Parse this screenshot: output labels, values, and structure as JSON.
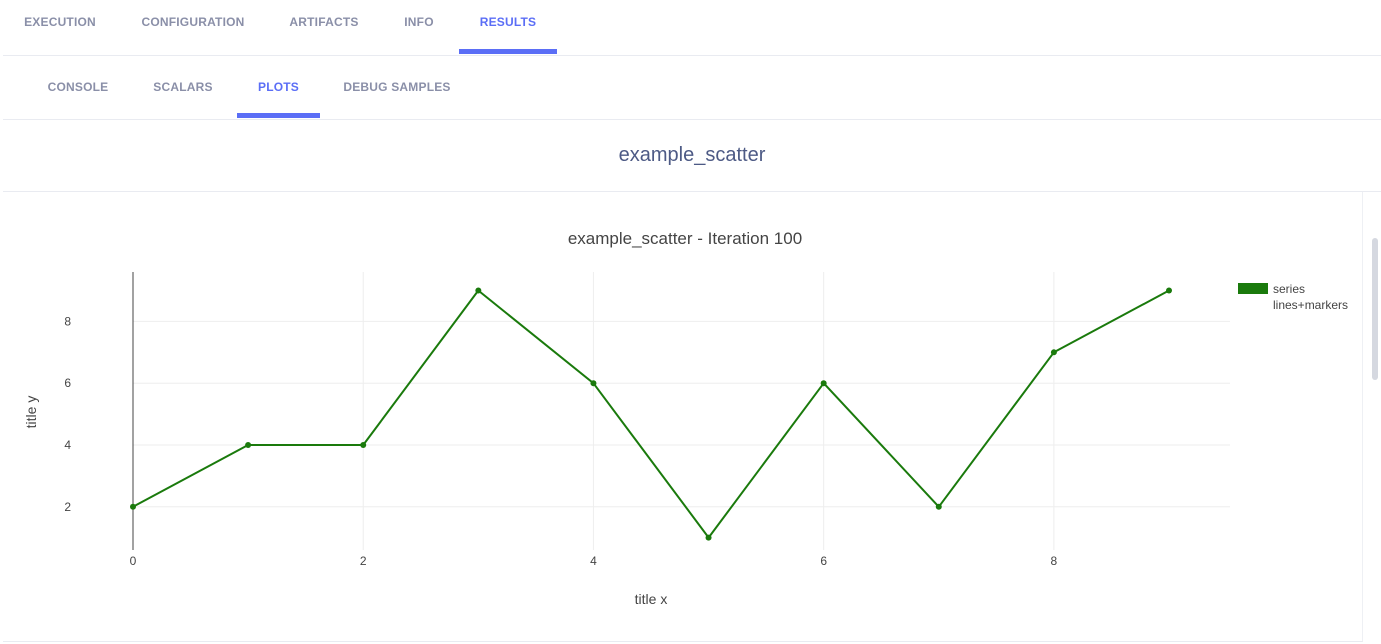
{
  "top_tabs": [
    {
      "label": "EXECUTION",
      "active": false
    },
    {
      "label": "CONFIGURATION",
      "active": false
    },
    {
      "label": "ARTIFACTS",
      "active": false
    },
    {
      "label": "INFO",
      "active": false
    },
    {
      "label": "RESULTS",
      "active": true
    }
  ],
  "sub_tabs": [
    {
      "label": "CONSOLE",
      "active": false
    },
    {
      "label": "SCALARS",
      "active": false
    },
    {
      "label": "PLOTS",
      "active": true
    },
    {
      "label": "DEBUG SAMPLES",
      "active": false
    }
  ],
  "plot_group": {
    "title": "example_scatter"
  },
  "colors": {
    "accent": "#5b6ef6",
    "series": "#1a7a0c",
    "tab_text": "#8a8fa8"
  },
  "chart_data": {
    "type": "line",
    "title": "example_scatter - Iteration 100",
    "xlabel": "title x",
    "ylabel": "title y",
    "xlim": [
      0,
      9
    ],
    "ylim": [
      0.6,
      9.6
    ],
    "x_ticks": [
      0,
      2,
      4,
      6,
      8
    ],
    "y_ticks": [
      2,
      4,
      6,
      8
    ],
    "grid": true,
    "legend_position": "top-right",
    "series": [
      {
        "name": "series lines+markers",
        "legend_lines": [
          "series",
          "lines+markers"
        ],
        "mode": "lines+markers",
        "color": "#1a7a0c",
        "x": [
          0,
          1,
          2,
          3,
          4,
          5,
          6,
          7,
          8,
          9
        ],
        "y": [
          2,
          4,
          4,
          9,
          6,
          1,
          6,
          2,
          7,
          9
        ]
      }
    ]
  }
}
